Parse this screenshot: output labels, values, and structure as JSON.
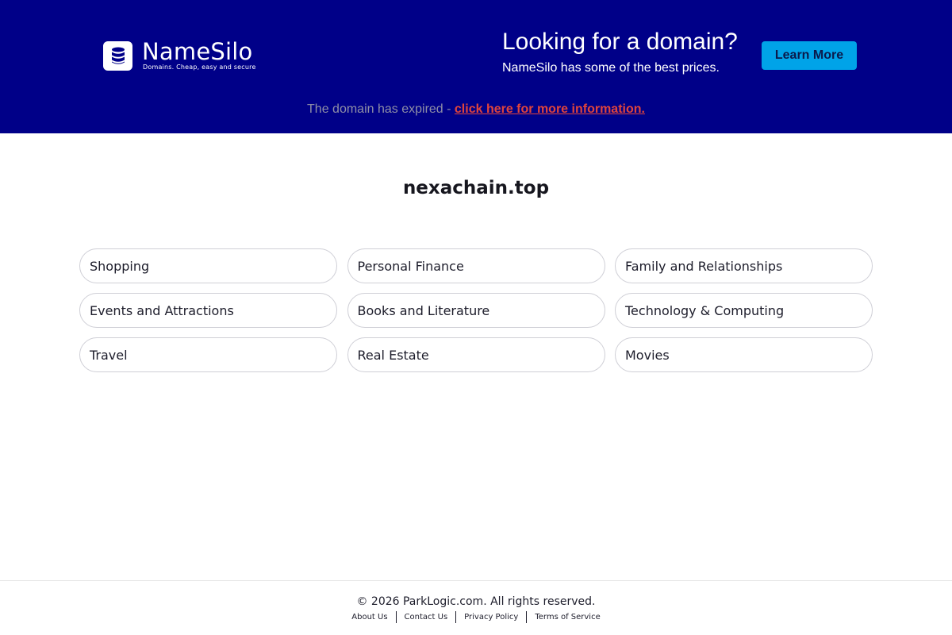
{
  "banner": {
    "logo": {
      "name": "NameSilo",
      "tagline": "Domains. Cheap, easy and secure"
    },
    "promo": {
      "title": "Looking for a domain?",
      "subtitle": "NameSilo has some of the best prices."
    },
    "learn_more_label": "Learn More",
    "expired": {
      "text": "The domain has expired - ",
      "link_text": "click here for more information."
    },
    "colors": {
      "background": "#000088",
      "button": "#00a3e8",
      "link": "#e0443c"
    }
  },
  "main": {
    "domain": "nexachain.top",
    "categories": [
      {
        "label": "Shopping"
      },
      {
        "label": "Personal Finance"
      },
      {
        "label": "Family and Relationships"
      },
      {
        "label": "Events and Attractions"
      },
      {
        "label": "Books and Literature"
      },
      {
        "label": "Technology & Computing"
      },
      {
        "label": "Travel"
      },
      {
        "label": "Real Estate"
      },
      {
        "label": "Movies"
      }
    ]
  },
  "footer": {
    "copyright": "© 2026 ParkLogic.com. All rights reserved.",
    "links": [
      {
        "label": "About Us"
      },
      {
        "label": "Contact Us"
      },
      {
        "label": "Privacy Policy"
      },
      {
        "label": "Terms of Service"
      }
    ]
  }
}
